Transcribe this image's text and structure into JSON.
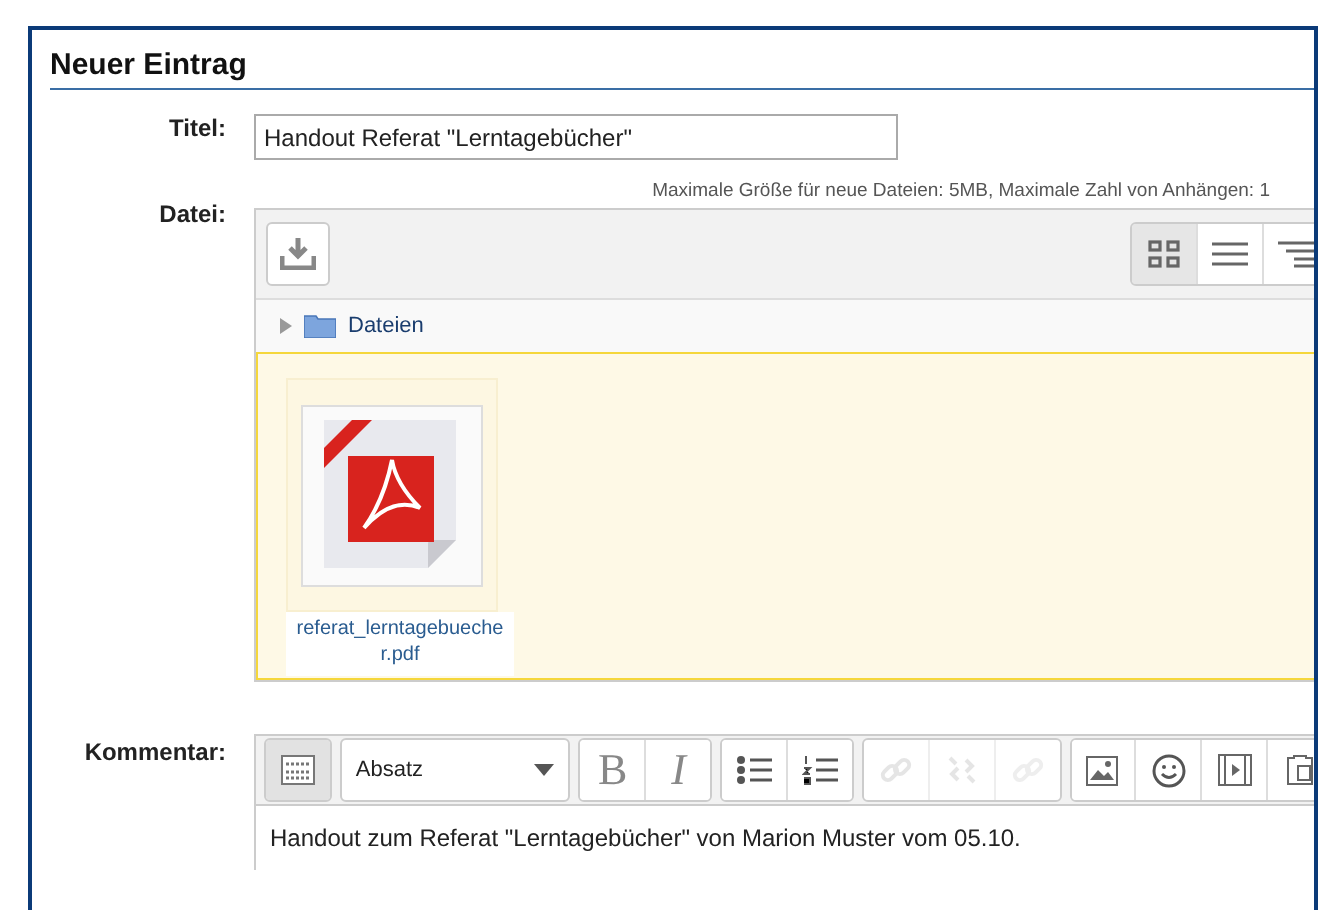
{
  "heading": "Neuer Eintrag",
  "title_field": {
    "label": "Titel:",
    "value": "Handout Referat \"Lerntagebücher\""
  },
  "file_field": {
    "label": "Datei:",
    "limits": "Maximale Größe für neue Dateien: 5MB, Maximale Zahl von Anhängen: 1",
    "views": [
      {
        "kind": "icons",
        "selected": true
      },
      {
        "kind": "list",
        "selected": false
      },
      {
        "kind": "tree",
        "selected": false
      }
    ],
    "folder": "Dateien",
    "files": [
      {
        "kind": "pdf",
        "name": "referat_lerntagebuecher.pdf"
      }
    ]
  },
  "comment_field": {
    "label": "Kommentar:",
    "format": "Absatz",
    "tool_groups": [
      [
        {
          "kind": "toggle",
          "pressed": true,
          "disabled": false
        }
      ],
      [
        {
          "kind": "format"
        }
      ],
      [
        {
          "kind": "bold",
          "label": "B",
          "disabled": false
        },
        {
          "kind": "italic",
          "label": "I",
          "disabled": false
        }
      ],
      [
        {
          "kind": "bullets",
          "disabled": false
        },
        {
          "kind": "numbers",
          "disabled": false
        }
      ],
      [
        {
          "kind": "link",
          "disabled": true
        },
        {
          "kind": "unlink",
          "disabled": true
        },
        {
          "kind": "anchor",
          "disabled": true
        }
      ],
      [
        {
          "kind": "image",
          "disabled": false
        },
        {
          "kind": "emoji",
          "disabled": false
        },
        {
          "kind": "media",
          "disabled": false
        },
        {
          "kind": "paste",
          "disabled": false
        }
      ]
    ],
    "text": "Handout zum Referat \"Lerntagebücher\" von Marion Muster vom 05.10."
  }
}
